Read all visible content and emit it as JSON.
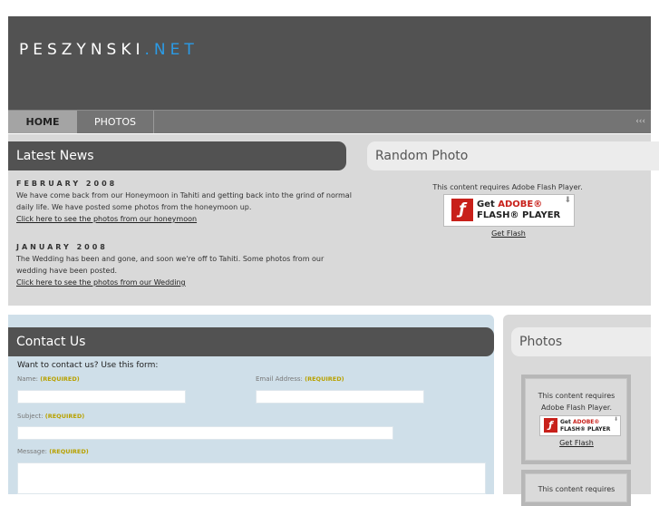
{
  "site": {
    "logo_main": "PESZYNSKI",
    "logo_tld": ".NET"
  },
  "nav": {
    "items": [
      "HOME",
      "PHOTOS"
    ],
    "collapse": "‹‹‹"
  },
  "latest_news": {
    "title": "Latest News",
    "entries": [
      {
        "date": "FEBRUARY 2008",
        "text": "We have come back from our Honeymoon in Tahiti and getting back into the grind of normal daily life. We have posted some photos from the honeymoon up.",
        "link": "Click here to see the photos from our honeymoon"
      },
      {
        "date": "JANUARY 2008",
        "text": "The Wedding has been and gone, and soon we're off to Tahiti. Some photos from our wedding have been posted.",
        "link": "Click here to see the photos from our Wedding"
      }
    ]
  },
  "random_photo": {
    "title": "Random Photo",
    "flash_notice": "This content requires Adobe Flash Player.",
    "badge_get": "Get",
    "badge_adobe": "ADOBE®",
    "badge_player": "FLASH® PLAYER",
    "get_flash": "Get Flash"
  },
  "contact": {
    "title": "Contact Us",
    "intro": "Want to contact us? Use this form:",
    "name_label": "Name:",
    "email_label": "Email Address:",
    "subject_label": "Subject:",
    "message_label": "Message:",
    "required_tag": "(REQUIRED)"
  },
  "photos": {
    "title": "Photos",
    "flash_notice": "This content requires Adobe Flash Player.",
    "flash_notice_partial": "This content requires",
    "badge_get": "Get",
    "badge_adobe": "ADOBE®",
    "badge_player": "FLASH® PLAYER",
    "get_flash": "Get Flash"
  },
  "colors": {
    "header": "#525252",
    "accent": "#2b9be6",
    "contact_bg": "#cfdfe9",
    "required": "#b8a100",
    "flash_red": "#c8201a"
  },
  "icons": {
    "flash_badge": "adobe-flash-icon",
    "download": "download-arrow-icon"
  }
}
